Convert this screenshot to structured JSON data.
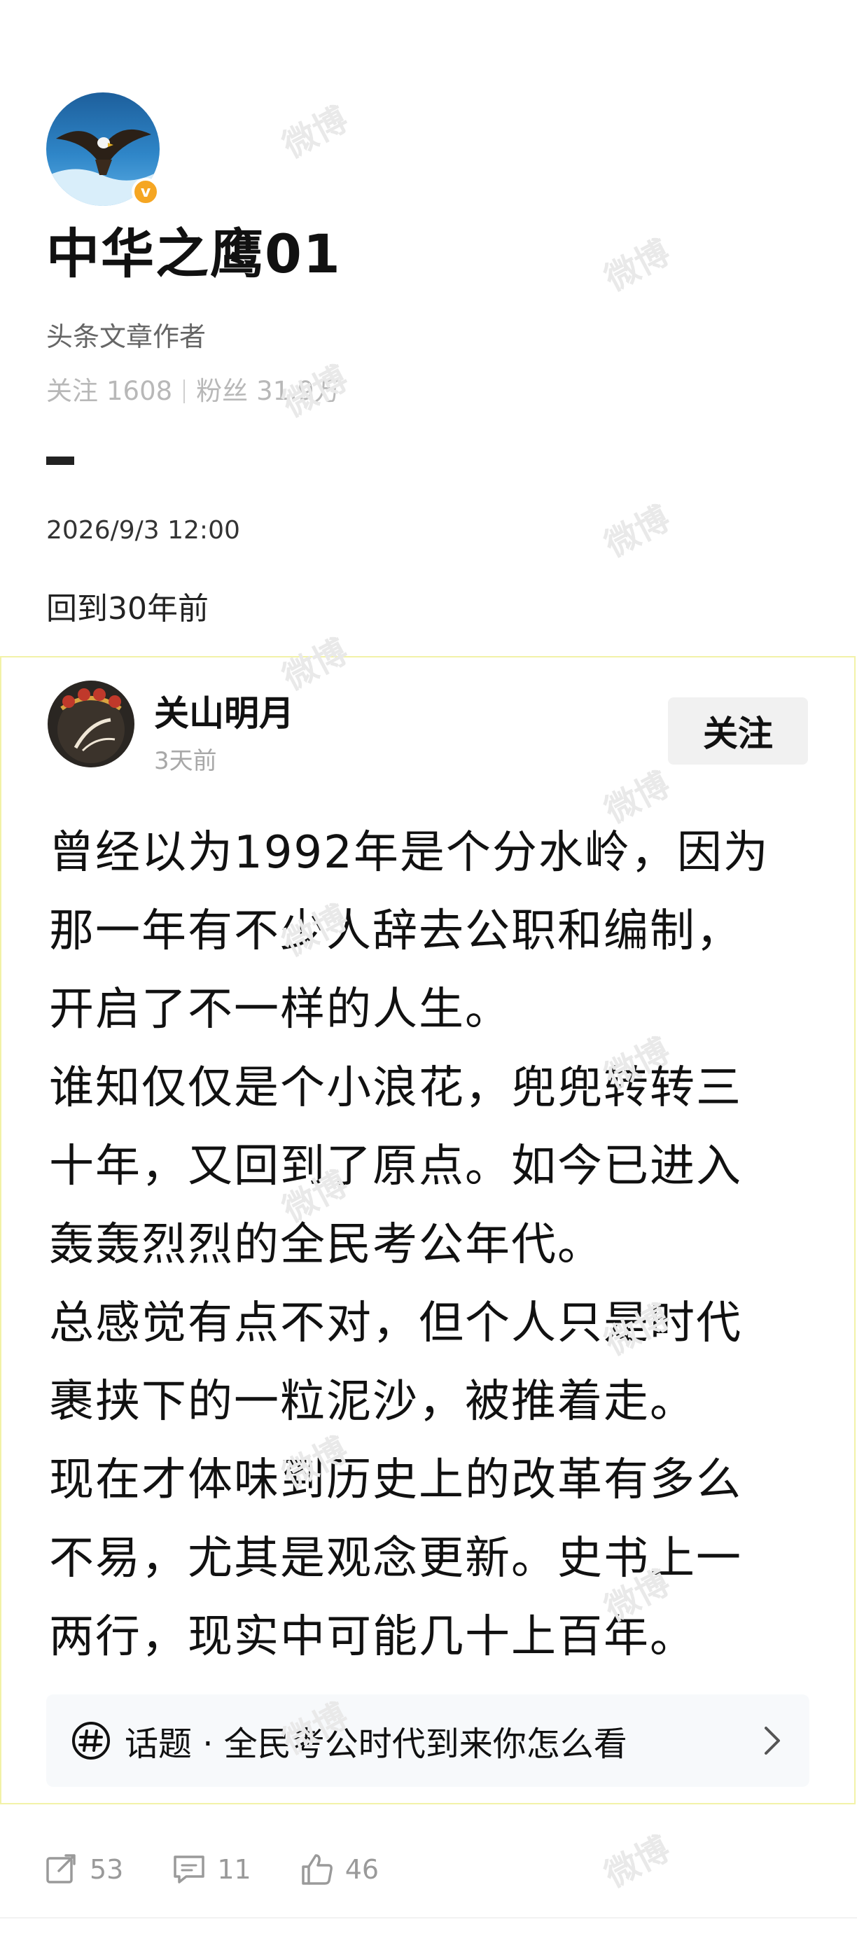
{
  "watermark": {
    "text": "微博"
  },
  "author": {
    "name": "中华之鹰01",
    "role": "头条文章作者",
    "follow_label": "关注",
    "follow_count": "1608",
    "fans_label": "粉丝",
    "fans_count": "31.9万",
    "verified_badge": "v"
  },
  "post": {
    "time": "2026/9/3 12:00",
    "text": "回到30年前"
  },
  "shared": {
    "user": "关山明月",
    "time": "3天前",
    "follow_button": "关注",
    "lines": [
      "曾经以为1992年是个分水岭，因为",
      "那一年有不少人辞去公职和编制，",
      "开启了不一样的人生。",
      "谁知仅仅是个小浪花，兜兜转转三",
      "十年，又回到了原点。如今已进入",
      "轰轰烈烈的全民考公年代。",
      "总感觉有点不对，但个人只是时代",
      "裹挟下的一粒泥沙，被推着走。",
      "现在才体味到历史上的改革有多么",
      "不易，尤其是观念更新。史书上一",
      "两行，现实中可能几十上百年。"
    ],
    "topic": "话题 · 全民考公时代到来你怎么看"
  },
  "actions": {
    "repost_count": "53",
    "comment_count": "11",
    "like_count": "46"
  },
  "colors": {
    "verified": "#f5a623",
    "card_border": "#f2f2a8",
    "muted_text": "#b8b8b8",
    "topic_bg": "#f7f9fb"
  }
}
